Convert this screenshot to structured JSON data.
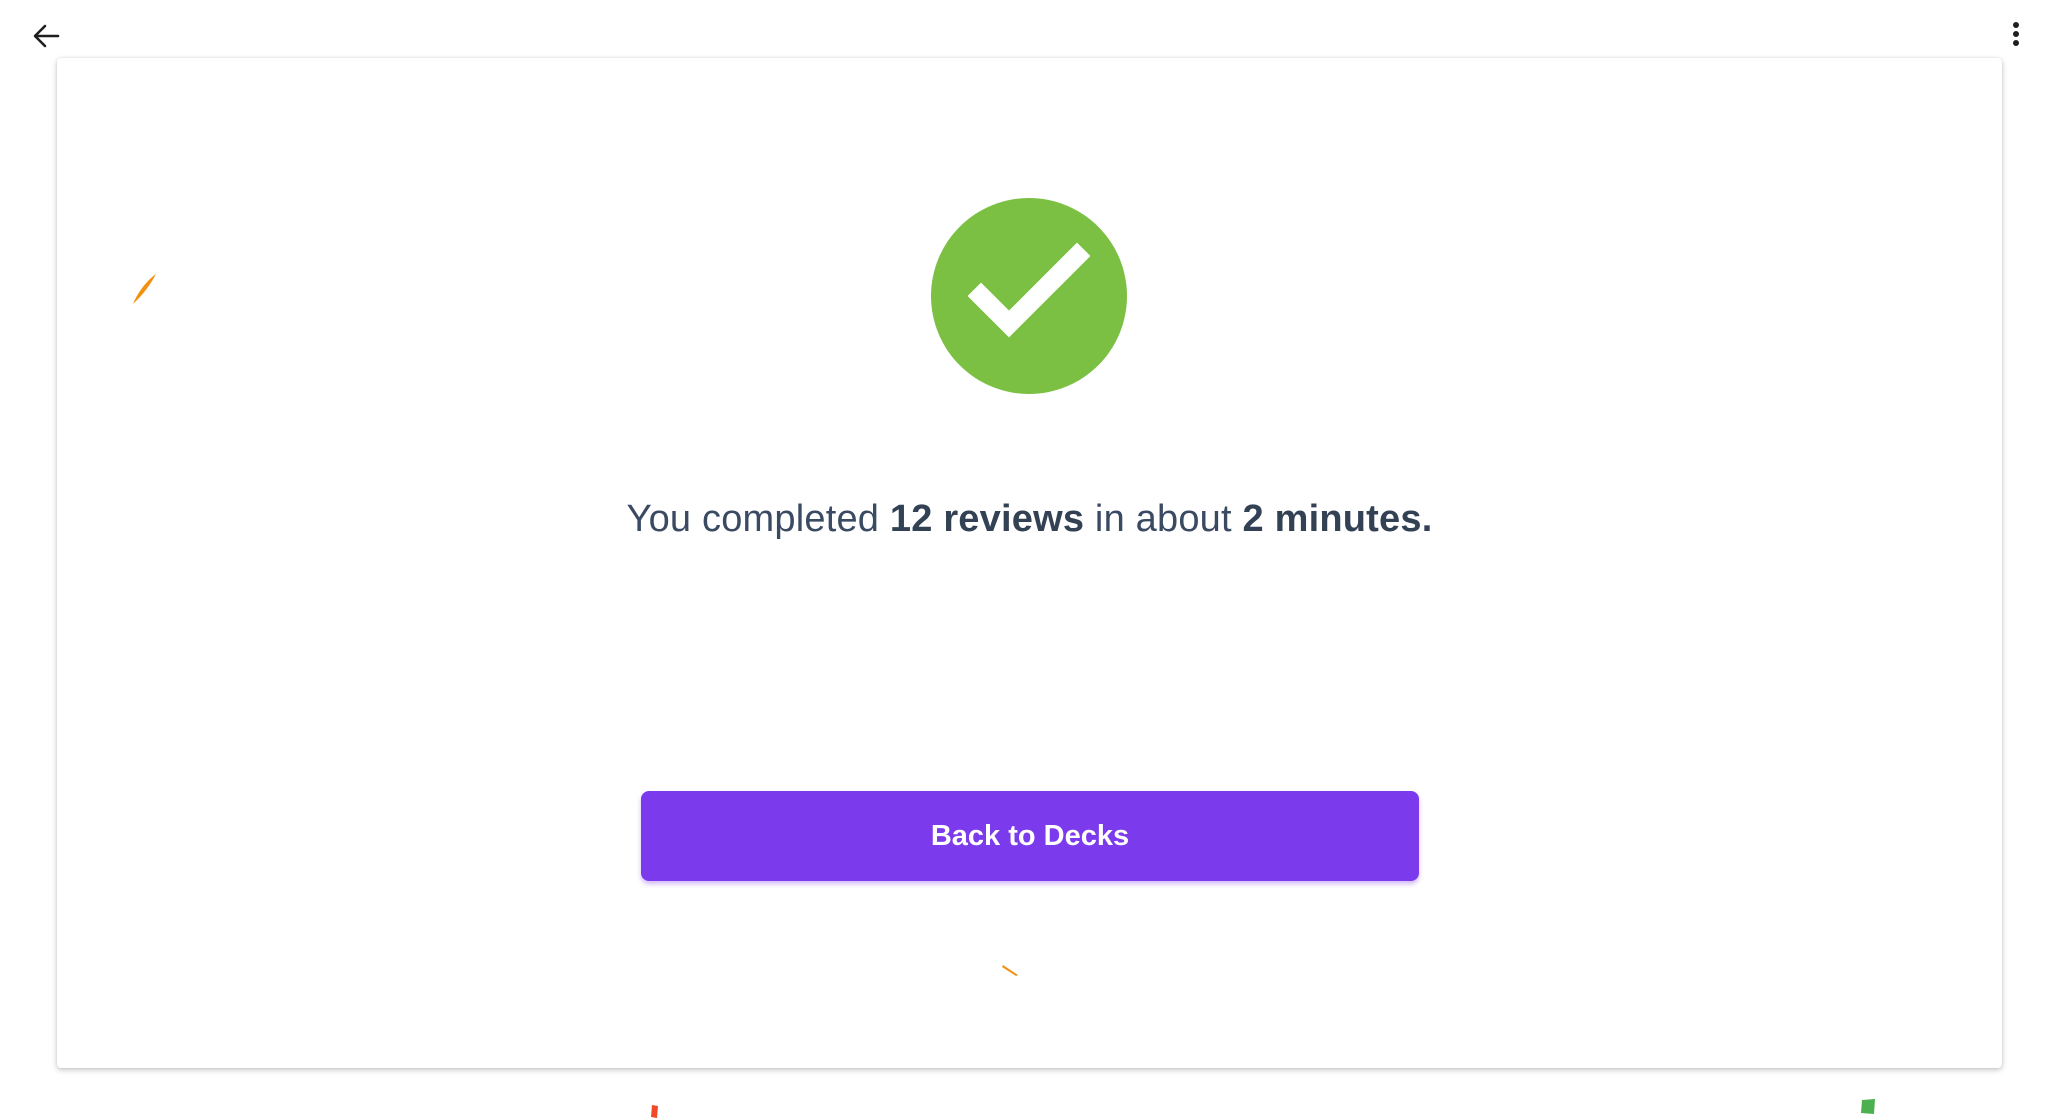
{
  "toolbar": {
    "back_icon": "arrow-left-icon",
    "menu_icon": "more-vertical-icon"
  },
  "completion": {
    "icon": "check-circle-icon",
    "prefix": "You completed",
    "review_count": "12 reviews",
    "middle": "in about",
    "duration": "2 minutes."
  },
  "actions": {
    "back_to_decks_label": "Back to Decks"
  },
  "colors": {
    "success": "#7bc043",
    "primary": "#7c3aed",
    "text": "#3b4a63",
    "confetti_orange": "#f29111",
    "confetti_red": "#f04a2a",
    "confetti_green": "#4caf50"
  }
}
